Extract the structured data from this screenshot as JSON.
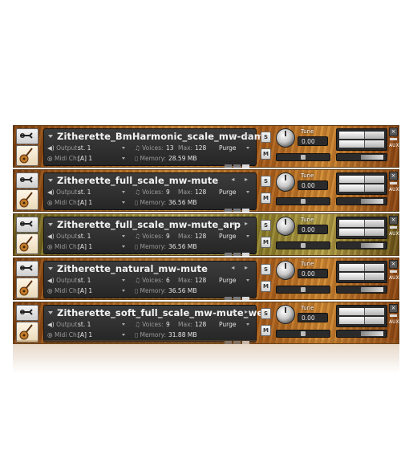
{
  "instruments": [
    {
      "name": "Zitherette_BmHarmonic_scale_mw-damp",
      "output_label": "Output:",
      "output": "st. 1",
      "voices_label": "Voices:",
      "voices": "13",
      "max_label": "Max:",
      "max": "128",
      "purge": "Purge",
      "midi_label": "Midi Ch:",
      "midi": "[A]  1",
      "memory_label": "Memory:",
      "memory": "28.59 MB",
      "tune_label": "Tune",
      "tune": "0.00",
      "s": "S",
      "m": "M",
      "aux": "AUX",
      "close": "×",
      "variant": "brown"
    },
    {
      "name": "Zitherette_full_scale_mw-mute",
      "output_label": "Output:",
      "output": "st. 1",
      "voices_label": "Voices:",
      "voices": "9",
      "max_label": "Max:",
      "max": "128",
      "purge": "Purge",
      "midi_label": "Midi Ch:",
      "midi": "[A]  1",
      "memory_label": "Memory:",
      "memory": "36.56 MB",
      "tune_label": "Tune",
      "tune": "0.00",
      "s": "S",
      "m": "M",
      "aux": "AUX",
      "close": "×",
      "variant": "brown"
    },
    {
      "name": "Zitherette_full_scale_mw-mute_arp",
      "output_label": "Output:",
      "output": "st. 1",
      "voices_label": "Voices:",
      "voices": "9",
      "max_label": "Max:",
      "max": "128",
      "purge": "Purge",
      "midi_label": "Midi Ch:",
      "midi": "[A]  1",
      "memory_label": "Memory:",
      "memory": "36.56 MB",
      "tune_label": "Tune",
      "tune": "0.00",
      "s": "S",
      "m": "M",
      "aux": "AUX",
      "close": "×",
      "variant": "green"
    },
    {
      "name": "Zitherette_natural_mw-mute",
      "output_label": "Output:",
      "output": "st. 1",
      "voices_label": "Voices:",
      "voices": "6",
      "max_label": "Max:",
      "max": "128",
      "purge": "Purge",
      "midi_label": "Midi Ch:",
      "midi": "[A]  1",
      "memory_label": "Memory:",
      "memory": "36.56 MB",
      "tune_label": "Tune",
      "tune": "0.00",
      "s": "S",
      "m": "M",
      "aux": "AUX",
      "close": "×",
      "variant": "brown"
    },
    {
      "name": "Zitherette_soft_full_scale_mw-mute_wet",
      "output_label": "Output:",
      "output": "st. 1",
      "voices_label": "Voices:",
      "voices": "9",
      "max_label": "Max:",
      "max": "128",
      "purge": "Purge",
      "midi_label": "Midi Ch:",
      "midi": "[A]  1",
      "memory_label": "Memory:",
      "memory": "31.88 MB",
      "tune_label": "Tune",
      "tune": "0.00",
      "s": "S",
      "m": "M",
      "aux": "AUX",
      "close": "×",
      "variant": "brown"
    }
  ],
  "icons": {
    "settings": "wrench-icon",
    "instrument": "guitar-icon",
    "output": "speaker-icon",
    "midi": "midi-port-icon",
    "voices": "voices-icon",
    "memory": "memory-icon",
    "prev": "chevron-left-icon",
    "next": "chevron-right-icon"
  },
  "colors": {
    "wood": "#a8621f",
    "panel": "#2e2e2e",
    "text": "#f2f2f2"
  }
}
